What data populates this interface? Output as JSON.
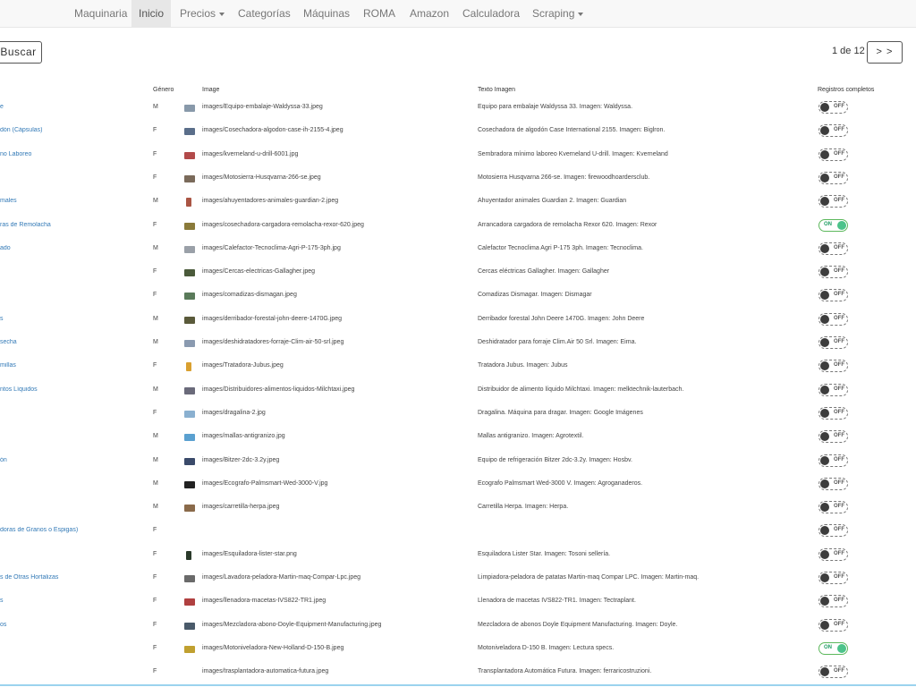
{
  "nav": {
    "items": [
      {
        "label": "Maquinaria"
      },
      {
        "label": "Inicio"
      },
      {
        "label": "Precios"
      },
      {
        "label": "Categorías"
      },
      {
        "label": "Máquinas"
      },
      {
        "label": "ROMA"
      },
      {
        "label": "Amazon"
      },
      {
        "label": "Calculadora"
      },
      {
        "label": "Scraping"
      }
    ]
  },
  "toolbar": {
    "search_label": "Buscar"
  },
  "pagination": {
    "info": "1 de 12",
    "next_label": "> >"
  },
  "table": {
    "headers": {
      "genero": "Género",
      "image": "Image",
      "texto": "Texto Imagen",
      "registros": "Registros completos"
    },
    "rows": [
      {
        "name": "e",
        "genero": "M",
        "image": "images/Equipo-embalaje-Waldyssa-33.jpeg",
        "texto": "Equipo para embalaje Waldyssa 33. Imagen: Waldyssa.",
        "toggle": "OFF",
        "thumb": "#8899aa"
      },
      {
        "name": "dón (Cápsulas)",
        "genero": "F",
        "image": "images/Cosechadora-algodon-case-ih-2155-4.jpeg",
        "texto": "Cosechadora de algodón Case International 2155. Imagen: Biglron.",
        "toggle": "OFF",
        "thumb": "#5a6e8a"
      },
      {
        "name": "no Laboreo",
        "genero": "F",
        "image": "images/kverneland-u-drill-6001.jpg",
        "texto": "Sembradora mínimo laboreo Kverneland U-drill. Imagen: Kverneland",
        "toggle": "OFF",
        "thumb": "#b24a4a"
      },
      {
        "name": "",
        "genero": "F",
        "image": "images/Motosierra-Husqvarna-266-se.jpeg",
        "texto": "Motosierra Husqvarna 266-se. Imagen: firewoodhoardersclub.",
        "toggle": "OFF",
        "thumb": "#7a6a5a"
      },
      {
        "name": "males",
        "genero": "M",
        "image": "images/ahuyentadores-animales-guardian-2.jpeg",
        "texto": "Ahuyentador animales Guardian 2. Imagen: Guardian",
        "toggle": "OFF",
        "thumb": "#aa5544"
      },
      {
        "name": "ras de Remolacha",
        "genero": "F",
        "image": "images/cosechadora-cargadora-remolacha-rexor-620.jpeg",
        "texto": "Arrancadora cargadora de remolacha Rexor 620. Imagen: Rexor",
        "toggle": "ON",
        "thumb": "#8a7a3a"
      },
      {
        "name": "ado",
        "genero": "M",
        "image": "images/Calefactor-Tecnoclima-Agri-P-175-3ph.jpg",
        "texto": "Calefactor Tecnoclima Agri P-175 3ph. Imagen: Tecnoclima.",
        "toggle": "OFF",
        "thumb": "#9aa0a8"
      },
      {
        "name": "",
        "genero": "F",
        "image": "images/Cercas-electricas-Gallagher.jpeg",
        "texto": "Cercas eléctricas Gallagher. Imagen: Gallagher",
        "toggle": "OFF",
        "thumb": "#4a5a3a"
      },
      {
        "name": "",
        "genero": "F",
        "image": "images/comadizas-dismagan.jpeg",
        "texto": "Comadizas Dismagar. Imagen: Dismagar",
        "toggle": "OFF",
        "thumb": "#5a7a5a"
      },
      {
        "name": "s",
        "genero": "M",
        "image": "images/derribador-forestal-john-deere-1470G.jpeg",
        "texto": "Derribador forestal John Deere 1470G. Imagen: John Deere",
        "toggle": "OFF",
        "thumb": "#5a5a3a"
      },
      {
        "name": "secha",
        "genero": "M",
        "image": "images/deshidratadores-forraje-Clim-air-50-srl.jpeg",
        "texto": "Deshidratador para forraje Clim.Air 50 Srl. Imagen: Eima.",
        "toggle": "OFF",
        "thumb": "#8a9ab0"
      },
      {
        "name": "millas",
        "genero": "F",
        "image": "images/Tratadora-Jubus.jpeg",
        "texto": "Tratadora Jubus. Imagen: Jubus",
        "toggle": "OFF",
        "thumb": "#d9a030"
      },
      {
        "name": "ntos Líquidos",
        "genero": "M",
        "image": "images/Distribuidores-alimentos-liquidos-Milchtaxi.jpeg",
        "texto": "Distribuidor de alimento líquido Milchtaxi. Imagen: melktechnik-lauterbach.",
        "toggle": "OFF",
        "thumb": "#6a6a7a"
      },
      {
        "name": "",
        "genero": "F",
        "image": "images/dragalina-2.jpg",
        "texto": "Dragalina. Máquina para dragar. Imagen: Google Imágenes",
        "toggle": "OFF",
        "thumb": "#8ab0d0"
      },
      {
        "name": "",
        "genero": "M",
        "image": "images/mallas-antigranizo.jpg",
        "texto": "Mallas antigranizo. Imagen: Agrotextil.",
        "toggle": "OFF",
        "thumb": "#5aa0d0"
      },
      {
        "name": "ón",
        "genero": "M",
        "image": "images/Bitzer-2dc-3.2y.jpeg",
        "texto": "Equipo de refrigeración Bitzer 2dc-3.2y. Imagen: Hosbv.",
        "toggle": "OFF",
        "thumb": "#3a4a6a"
      },
      {
        "name": "",
        "genero": "M",
        "image": "images/Ecografo-Palmsmart-Wed-3000-V.jpg",
        "texto": "Ecografo Palmsmart Wed-3000 V. Imagen: Agroganaderos.",
        "toggle": "OFF",
        "thumb": "#222222"
      },
      {
        "name": "",
        "genero": "M",
        "image": "images/carretilla-herpa.jpeg",
        "texto": "Carretilla Herpa. Imagen: Herpa.",
        "toggle": "OFF",
        "thumb": "#8a6a4a"
      },
      {
        "name": "doras de Granos o Espigas)",
        "genero": "F",
        "image": "",
        "texto": "",
        "toggle": "OFF",
        "thumb": ""
      },
      {
        "name": "",
        "genero": "F",
        "image": "images/Esquiladora-lister-star.png",
        "texto": "Esquiladora Lister Star. Imagen: Tosoni sellería.",
        "toggle": "OFF",
        "thumb": "#2a3a2a"
      },
      {
        "name": "s de Otras Hortalizas",
        "genero": "F",
        "image": "images/Lavadora-peladora-Martin-maq-Compar-Lpc.jpeg",
        "texto": "Limpiadora-peladora de patatas Martin-maq Compar LPC. Imagen: Martin-maq.",
        "toggle": "OFF",
        "thumb": "#6a6a6a"
      },
      {
        "name": "s",
        "genero": "F",
        "image": "images/llenadora-macetas-IVS822-TR1.jpeg",
        "texto": "Llenadora de macetas IVS822-TR1. Imagen: Tectraplant.",
        "toggle": "OFF",
        "thumb": "#b04040"
      },
      {
        "name": "os",
        "genero": "F",
        "image": "images/Mezcladora-abono-Doyle-Equipment-Manufacturing.jpeg",
        "texto": "Mezcladora de abonos Doyle Equipment Manufacturing. Imagen: Doyle.",
        "toggle": "OFF",
        "thumb": "#4a5a6a"
      },
      {
        "name": "",
        "genero": "F",
        "image": "images/Motoniveladora-New-Holland-D-150-B.jpeg",
        "texto": "Motoniveladora D-150 B. Imagen: Lectura specs.",
        "toggle": "ON",
        "thumb": "#c0a030"
      },
      {
        "name": "",
        "genero": "F",
        "image": "images/trasplantadora-automatica-futura.jpeg",
        "texto": "Transplantadora Automática Futura. Imagen: ferraricostruzioni.",
        "toggle": "OFF",
        "thumb": ""
      }
    ]
  }
}
